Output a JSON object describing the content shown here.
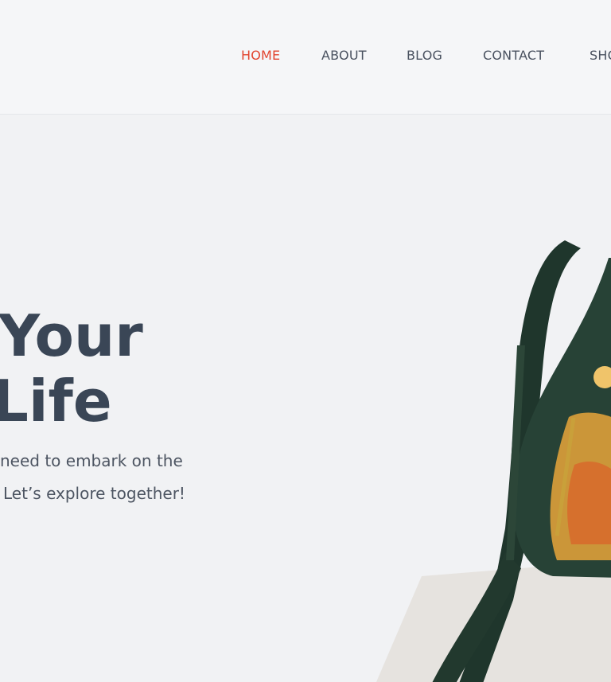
{
  "nav": {
    "items": [
      {
        "label": "HOME",
        "active": true
      },
      {
        "label": "ABOUT",
        "active": false
      },
      {
        "label": "BLOG",
        "active": false
      },
      {
        "label": "CONTACT",
        "active": false
      },
      {
        "label": "SHO",
        "active": false
      }
    ]
  },
  "hero": {
    "headline_line1": "Your",
    "headline_line2": "Life",
    "subtitle_line1": "need to embark on the",
    "subtitle_line2": "Let’s explore together!"
  },
  "colors": {
    "accent": "#e2452f",
    "heading": "#3a4656",
    "bag_green": "#274236"
  },
  "images": {
    "product": "green-drawstring-bag-with-krishna-print"
  }
}
